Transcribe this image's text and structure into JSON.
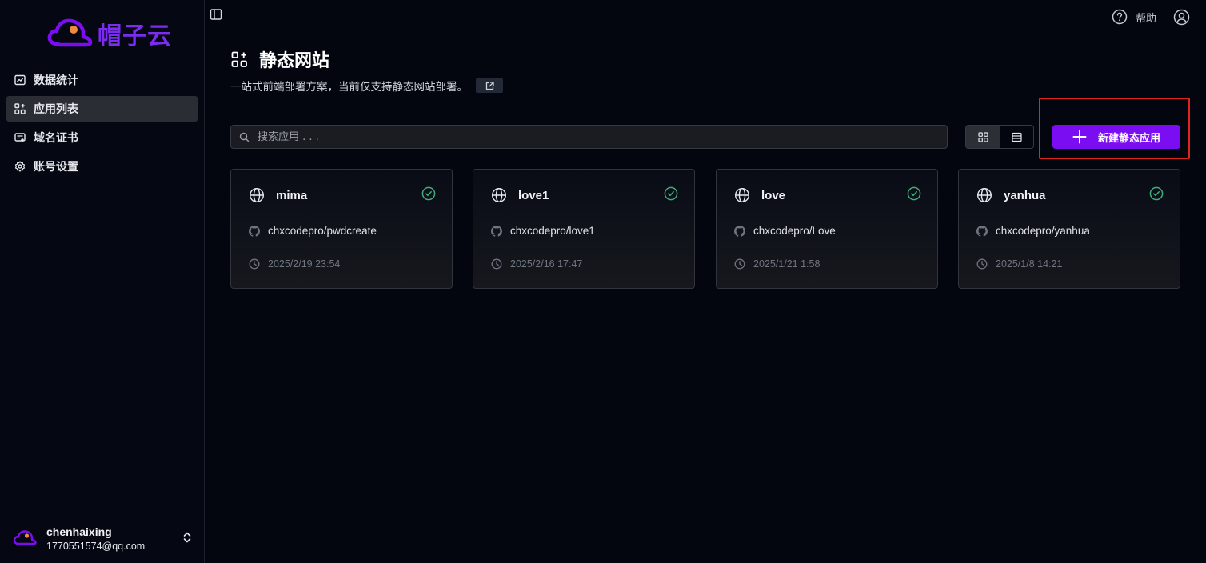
{
  "app": {
    "logo_text": "帽子云",
    "brand_color": "#7b0df2"
  },
  "sidebar": {
    "items": [
      {
        "label": "数据统计",
        "icon": "chart-icon",
        "active": false
      },
      {
        "label": "应用列表",
        "icon": "apps-icon",
        "active": true
      },
      {
        "label": "域名证书",
        "icon": "certificate-icon",
        "active": false
      },
      {
        "label": "账号设置",
        "icon": "gear-icon",
        "active": false
      }
    ],
    "user": {
      "name": "chenhaixing",
      "email": "1770551574@qq.com"
    }
  },
  "topbar": {
    "help_label": "帮助"
  },
  "page": {
    "title": "静态网站",
    "subtitle": "一站式前端部署方案，当前仅支持静态网站部署。"
  },
  "toolbar": {
    "search_placeholder": "搜索应用 . . .",
    "new_button_label": "新建静态应用",
    "active_view": "grid"
  },
  "apps": [
    {
      "name": "mima",
      "repo": "chxcodepro/pwdcreate",
      "time": "2025/2/19 23:54",
      "status": "success"
    },
    {
      "name": "love1",
      "repo": "chxcodepro/love1",
      "time": "2025/2/16 17:47",
      "status": "success"
    },
    {
      "name": "love",
      "repo": "chxcodepro/Love",
      "time": "2025/1/21 1:58",
      "status": "success"
    },
    {
      "name": "yanhua",
      "repo": "chxcodepro/yanhua",
      "time": "2025/1/8 14:21",
      "status": "success"
    }
  ]
}
